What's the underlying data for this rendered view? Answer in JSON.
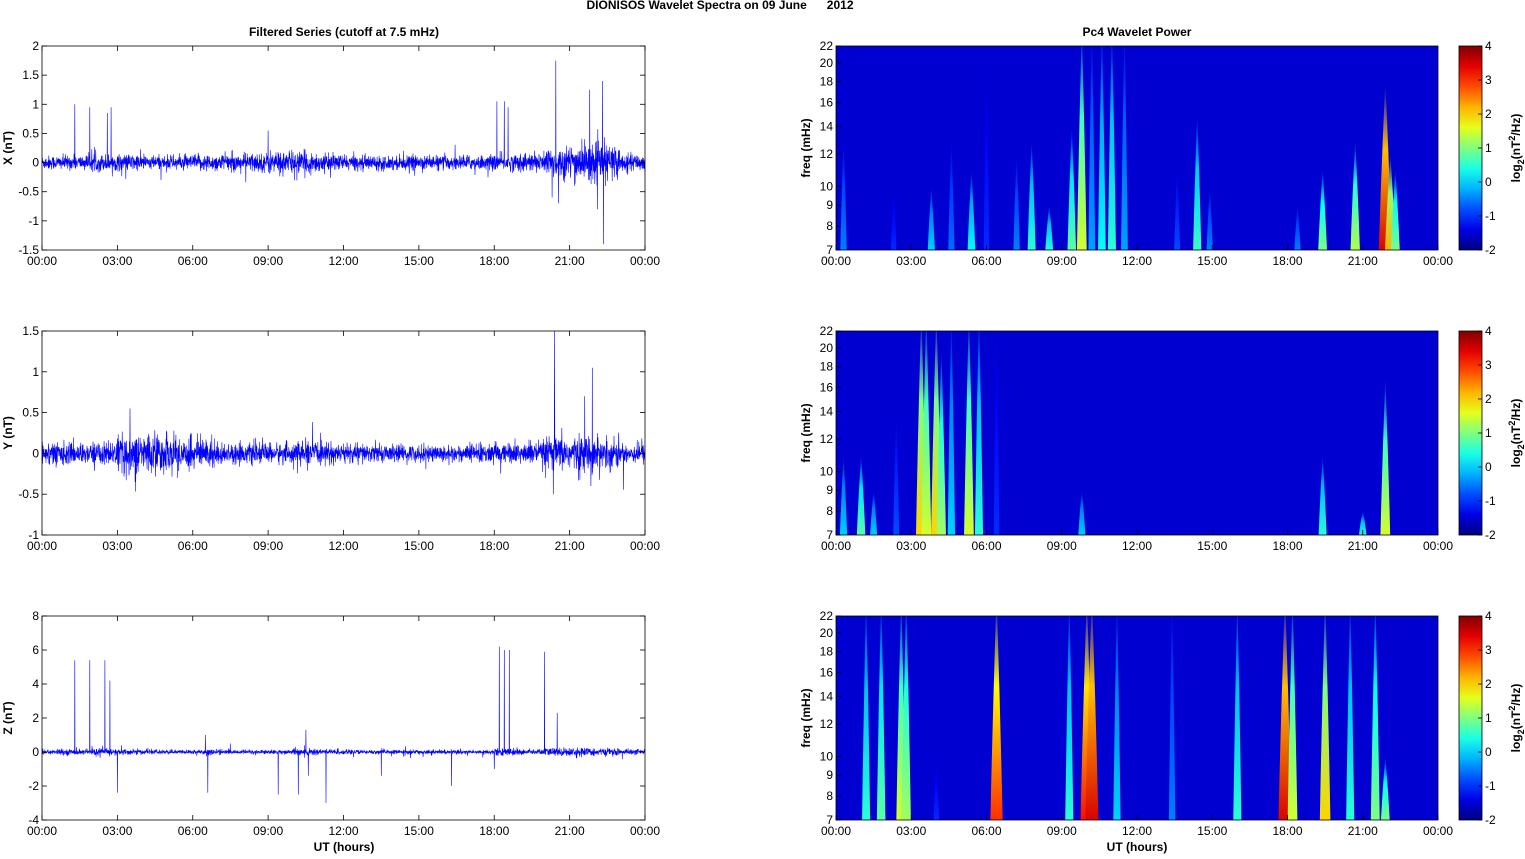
{
  "chart_data": {
    "type": "line+heatmap",
    "title": "DIONISOS Wavelet Spectra on 09 June      2012",
    "left_title": "Filtered Series (cutoff at 7.5 mHz)",
    "right_title": "Pc4 Wavelet Power",
    "xlabel": "UT (hours)",
    "xlim": [
      0,
      24
    ],
    "x_ticks": [
      0,
      3,
      6,
      9,
      12,
      15,
      18,
      21,
      24
    ],
    "x_tick_labels": [
      "00:00",
      "03:00",
      "06:00",
      "09:00",
      "12:00",
      "15:00",
      "18:00",
      "21:00",
      "00:00"
    ],
    "freq_label": "freq (mHz)",
    "freq_range": [
      7,
      22
    ],
    "freq_ticks": [
      7,
      8,
      9,
      10,
      12,
      14,
      16,
      18,
      20,
      22
    ],
    "colorbar": {
      "label": "log2(nT^2/Hz)",
      "label_base": "log",
      "label_sub": "2",
      "label_mid": "(nT",
      "label_sup": "2",
      "label_end": "/Hz)",
      "range": [
        -2,
        4
      ],
      "ticks": [
        -2,
        -1,
        0,
        1,
        2,
        3,
        4
      ]
    },
    "line_color": "#0000ff",
    "series": [
      {
        "name": "X",
        "ylabel": "X (nT)",
        "ylim": [
          -1.5,
          2
        ],
        "yticks": [
          -1.5,
          -1,
          -0.5,
          0,
          0.5,
          1,
          1.5,
          2
        ],
        "noise_std_by_hour": [
          0.06,
          0.06,
          0.07,
          0.07,
          0.06,
          0.06,
          0.07,
          0.07,
          0.08,
          0.1,
          0.09,
          0.07,
          0.06,
          0.06,
          0.06,
          0.06,
          0.06,
          0.06,
          0.07,
          0.08,
          0.13,
          0.15,
          0.15,
          0.07
        ],
        "spikes": [
          [
            1.3,
            1.0
          ],
          [
            1.9,
            0.95
          ],
          [
            2.6,
            0.85
          ],
          [
            2.75,
            0.95
          ],
          [
            9.0,
            0.55
          ],
          [
            18.1,
            1.05
          ],
          [
            18.4,
            1.05
          ],
          [
            18.55,
            0.95
          ],
          [
            20.3,
            -0.6
          ],
          [
            20.45,
            1.75
          ],
          [
            20.55,
            -0.7
          ],
          [
            21.2,
            -0.4
          ],
          [
            21.6,
            0.4
          ],
          [
            21.8,
            1.25
          ],
          [
            22.1,
            -0.8
          ],
          [
            22.3,
            1.4
          ],
          [
            22.35,
            -1.4
          ]
        ],
        "spectrum_events": [
          [
            0.3,
            13,
            -0.5
          ],
          [
            2.3,
            10,
            -1
          ],
          [
            3.8,
            10,
            0
          ],
          [
            4.6,
            13,
            -0.6
          ],
          [
            5.4,
            11,
            0.3
          ],
          [
            6.0,
            20,
            -1
          ],
          [
            7.2,
            12,
            -0.5
          ],
          [
            7.8,
            13,
            0.5
          ],
          [
            8.5,
            9,
            0.5
          ],
          [
            9.4,
            14,
            0.8
          ],
          [
            9.8,
            22,
            1.5
          ],
          [
            10.2,
            22,
            -0.3
          ],
          [
            10.6,
            22,
            0.3
          ],
          [
            11.0,
            22,
            0.5
          ],
          [
            11.5,
            22,
            -0.3
          ],
          [
            13.6,
            11,
            -0.8
          ],
          [
            14.4,
            15,
            0.6
          ],
          [
            14.9,
            10,
            -0.5
          ],
          [
            18.4,
            9,
            -0.5
          ],
          [
            19.4,
            11,
            1
          ],
          [
            20.7,
            13,
            1.3
          ],
          [
            21.9,
            18,
            3.5
          ],
          [
            22.1,
            12,
            2.2
          ],
          [
            22.3,
            11,
            1
          ]
        ]
      },
      {
        "name": "Y",
        "ylabel": "Y (nT)",
        "ylim": [
          -1,
          1.5
        ],
        "yticks": [
          -1,
          -0.5,
          0,
          0.5,
          1,
          1.5
        ],
        "noise_std_by_hour": [
          0.07,
          0.06,
          0.07,
          0.11,
          0.12,
          0.1,
          0.09,
          0.06,
          0.06,
          0.06,
          0.07,
          0.06,
          0.06,
          0.05,
          0.05,
          0.05,
          0.05,
          0.06,
          0.06,
          0.07,
          0.1,
          0.1,
          0.09,
          0.06
        ],
        "spikes": [
          [
            3.5,
            0.55
          ],
          [
            3.7,
            -0.35
          ],
          [
            5.4,
            -0.3
          ],
          [
            20.35,
            -0.5
          ],
          [
            20.4,
            1.5
          ],
          [
            21.6,
            0.7
          ],
          [
            21.85,
            -0.4
          ],
          [
            21.9,
            1.05
          ]
        ],
        "spectrum_events": [
          [
            0.3,
            11,
            0
          ],
          [
            1.0,
            11,
            0.8
          ],
          [
            1.5,
            9,
            0
          ],
          [
            2.4,
            14,
            -0.8
          ],
          [
            3.4,
            22,
            2
          ],
          [
            3.6,
            22,
            1.5
          ],
          [
            4.0,
            22,
            2
          ],
          [
            4.2,
            20,
            1.2
          ],
          [
            4.6,
            22,
            0
          ],
          [
            5.3,
            22,
            1.5
          ],
          [
            5.7,
            22,
            0.5
          ],
          [
            6.4,
            22,
            -1
          ],
          [
            9.8,
            9,
            0
          ],
          [
            19.4,
            11,
            0.5
          ],
          [
            21.0,
            8,
            0.5
          ],
          [
            21.9,
            17,
            1.5
          ]
        ]
      },
      {
        "name": "Z",
        "ylabel": "Z (nT)",
        "ylim": [
          -4,
          8
        ],
        "yticks": [
          -4,
          -2,
          0,
          2,
          4,
          6,
          8
        ],
        "noise_std_by_hour": [
          0.08,
          0.08,
          0.1,
          0.08,
          0.06,
          0.06,
          0.08,
          0.06,
          0.06,
          0.06,
          0.12,
          0.08,
          0.06,
          0.06,
          0.06,
          0.06,
          0.06,
          0.06,
          0.1,
          0.08,
          0.12,
          0.12,
          0.1,
          0.08
        ],
        "spikes": [
          [
            1.3,
            5.4
          ],
          [
            1.9,
            5.4
          ],
          [
            2.5,
            5.4
          ],
          [
            2.7,
            4.2
          ],
          [
            3.0,
            -2.4
          ],
          [
            6.5,
            1.0
          ],
          [
            6.6,
            -2.4
          ],
          [
            9.4,
            -2.5
          ],
          [
            10.2,
            -2.5
          ],
          [
            10.5,
            1.3
          ],
          [
            10.6,
            -1.4
          ],
          [
            11.3,
            -3.0
          ],
          [
            13.5,
            -1.4
          ],
          [
            16.3,
            -2.0
          ],
          [
            18.0,
            -1.0
          ],
          [
            18.2,
            6.2
          ],
          [
            18.4,
            6.0
          ],
          [
            18.6,
            6.0
          ],
          [
            20.0,
            5.9
          ],
          [
            20.5,
            2.3
          ]
        ],
        "spectrum_events": [
          [
            1.2,
            22,
            0.5
          ],
          [
            1.8,
            22,
            0.8
          ],
          [
            2.6,
            22,
            1.5
          ],
          [
            2.8,
            22,
            1.2
          ],
          [
            4.0,
            10,
            -1
          ],
          [
            6.4,
            22,
            3.0
          ],
          [
            9.3,
            22,
            0.5
          ],
          [
            10.0,
            22,
            3.2
          ],
          [
            10.2,
            22,
            3.5
          ],
          [
            11.2,
            22,
            0
          ],
          [
            13.4,
            22,
            -0.5
          ],
          [
            16.0,
            22,
            0.5
          ],
          [
            17.9,
            22,
            3.5
          ],
          [
            18.2,
            22,
            1.5
          ],
          [
            19.5,
            22,
            2
          ],
          [
            20.5,
            22,
            0.5
          ],
          [
            21.5,
            22,
            1
          ],
          [
            21.9,
            10,
            1
          ]
        ]
      }
    ]
  }
}
